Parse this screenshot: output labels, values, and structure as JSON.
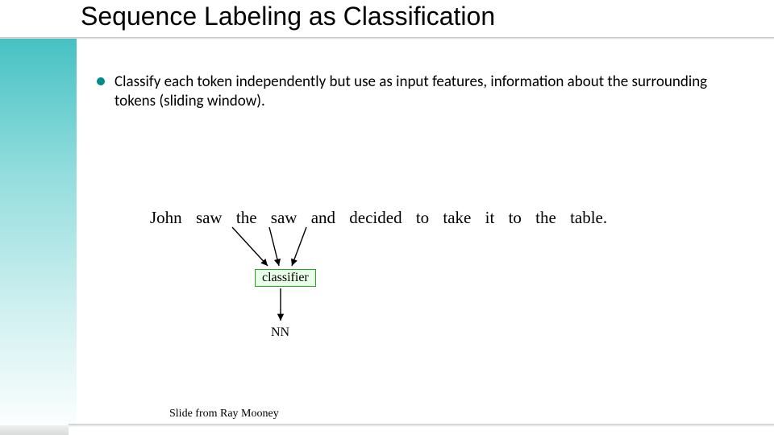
{
  "slide": {
    "title": "Sequence Labeling as Classification",
    "bullet": "Classify each token independently but use as input features, information about the surrounding tokens (sliding window).",
    "sentence_words": [
      "John",
      "saw",
      "the",
      "saw",
      "and",
      "decided",
      "to",
      "take",
      "it",
      "to",
      "the",
      "table."
    ],
    "classifier_label": "classifier",
    "output_tag": "NN",
    "credit": "Slide from Ray Mooney"
  },
  "colors": {
    "accent": "#3dbec0",
    "bullet_dot": "#008b8b",
    "box_border": "#2aa32a",
    "box_fill": "#eaffea"
  }
}
